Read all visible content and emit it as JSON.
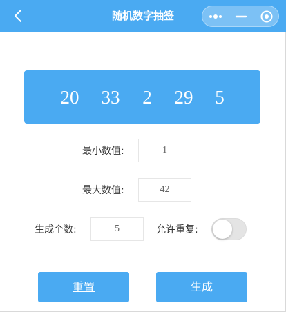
{
  "header": {
    "title": "随机数字抽签"
  },
  "result": {
    "numbers": [
      "20",
      "33",
      "2",
      "29",
      "5"
    ]
  },
  "form": {
    "min_label": "最小数值:",
    "min_value": "1",
    "max_label": "最大数值:",
    "max_value": "42",
    "count_label": "生成个数:",
    "count_value": "5",
    "repeat_label": "允许重复:",
    "repeat_enabled": false
  },
  "buttons": {
    "reset_label": "重置",
    "generate_label": "生成"
  },
  "colors": {
    "accent": "#4aaaf2",
    "toggle_off": "#e4e4e4"
  },
  "icons": {
    "back": "chevron-left-icon",
    "more": "more-dots-icon",
    "minimize": "minus-icon",
    "close": "target-circle-icon"
  }
}
